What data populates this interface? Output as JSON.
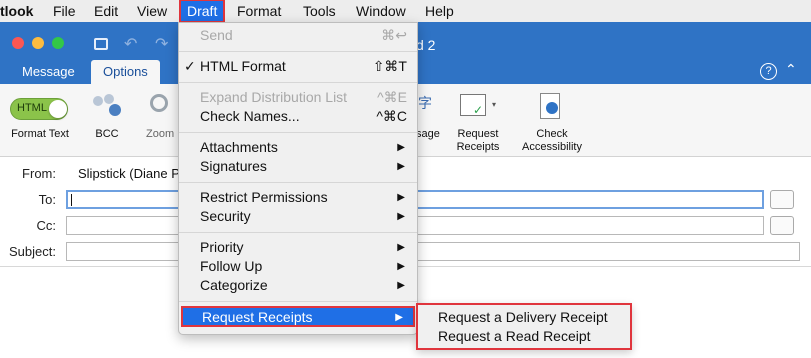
{
  "menubar": {
    "app_name": "tlook",
    "items": [
      "File",
      "Edit",
      "View",
      "Draft",
      "Format",
      "Tools",
      "Window",
      "Help"
    ],
    "active": "Draft"
  },
  "window": {
    "title_fragment": "d 2",
    "tabs": [
      "Message",
      "Options"
    ],
    "active_tab": "Options"
  },
  "ribbon": {
    "html_toggle": "HTML",
    "format_text": "Format Text",
    "bcc": "BCC",
    "zoom": "Zoom",
    "message_fragment": "sage",
    "request_receipts": "Request\nReceipts",
    "check_accessibility": "Check\nAccessibility",
    "help_icon": "?"
  },
  "header": {
    "from_label": "From:",
    "from_value": "Slipstick (Diane P",
    "to_label": "To:",
    "cc_label": "Cc:",
    "subject_label": "Subject:"
  },
  "draft_menu": {
    "send": "Send",
    "send_shortcut": "⌘↩",
    "html_format": "HTML Format",
    "html_format_check": "✓",
    "html_format_shortcut": "⇧⌘T",
    "expand_dl": "Expand Distribution List",
    "expand_dl_shortcut": "^⌘E",
    "check_names": "Check Names...",
    "check_names_shortcut": "^⌘C",
    "attachments": "Attachments",
    "signatures": "Signatures",
    "restrict_permissions": "Restrict Permissions",
    "security": "Security",
    "priority": "Priority",
    "follow_up": "Follow Up",
    "categorize": "Categorize",
    "request_receipts": "Request Receipts",
    "submenu_arrow": "▶"
  },
  "receipts_submenu": {
    "delivery": "Request a Delivery Receipt",
    "read": "Request a Read Receipt"
  },
  "colors": {
    "accent_blue": "#2f73c5",
    "highlight": "#1f6fe6",
    "annotation_red": "#e0353d"
  }
}
